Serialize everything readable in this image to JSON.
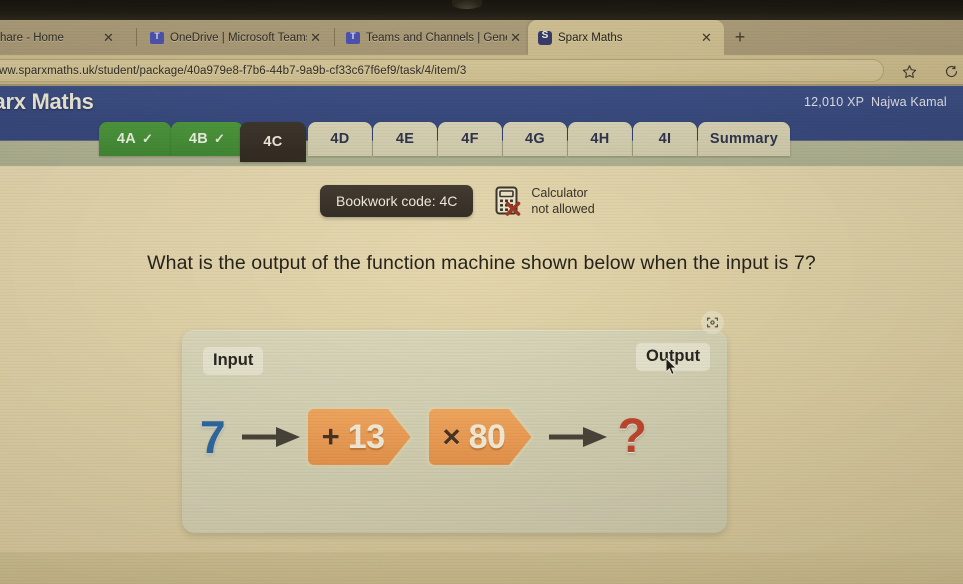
{
  "browser": {
    "tabs": [
      {
        "title": "hare - Home",
        "favicon": "none",
        "active": false,
        "closable": true
      },
      {
        "title": "OneDrive | Microsoft Teams",
        "favicon": "teams-icon",
        "active": false,
        "closable": true
      },
      {
        "title": "Teams and Channels | General | M",
        "favicon": "teams-icon",
        "active": false,
        "closable": true
      },
      {
        "title": "Sparx Maths",
        "favicon": "sparx-icon",
        "active": true,
        "closable": true
      }
    ],
    "new_tab_label": "+",
    "close_glyph": "✕",
    "address": "ww.sparxmaths.uk/student/package/40a979e8-f7b6-44b7-9a9b-cf33c67f6ef9/task/4/item/3",
    "toolbar_icons": [
      {
        "name": "favorite-star-icon"
      },
      {
        "name": "browser-profile-icon"
      }
    ]
  },
  "app_header": {
    "brand": "Sparx Maths",
    "brand_visible": "ns",
    "xp": "12,010 XP",
    "username": "Najwa Kamal"
  },
  "task_tabs": [
    {
      "label": "4A",
      "state": "done",
      "check": "✓"
    },
    {
      "label": "4B",
      "state": "done",
      "check": "✓"
    },
    {
      "label": "4C",
      "state": "current",
      "check": ""
    },
    {
      "label": "4D",
      "state": "upcoming",
      "check": ""
    },
    {
      "label": "4E",
      "state": "upcoming",
      "check": ""
    },
    {
      "label": "4F",
      "state": "upcoming",
      "check": ""
    },
    {
      "label": "4G",
      "state": "upcoming",
      "check": ""
    },
    {
      "label": "4H",
      "state": "upcoming",
      "check": ""
    },
    {
      "label": "4I",
      "state": "upcoming",
      "check": ""
    },
    {
      "label": "Summary",
      "state": "upcoming",
      "check": ""
    }
  ],
  "question_area": {
    "bookwork_code": "Bookwork code: 4C",
    "calculator_line1": "Calculator",
    "calculator_line2": "not allowed",
    "question_text": "What is the output of the function machine shown below when the input is 7?"
  },
  "function_machine": {
    "input_label": "Input",
    "output_label": "Output",
    "input_value": "7",
    "output_value": "?",
    "operations": [
      {
        "symbol": "+",
        "value": "13"
      },
      {
        "symbol": "×",
        "value": "80"
      }
    ],
    "expand_icon": "fullscreen-expand-icon"
  },
  "colors": {
    "header_blue": "#354882",
    "tab_done_green": "#4c9a3f",
    "tab_current_dark": "#332d26",
    "operation_orange": "#f2a058",
    "input_blue": "#2c6aa8",
    "output_red": "#c2462f",
    "page_background": "#e4d7af",
    "panel_background": "#dad8bd"
  }
}
